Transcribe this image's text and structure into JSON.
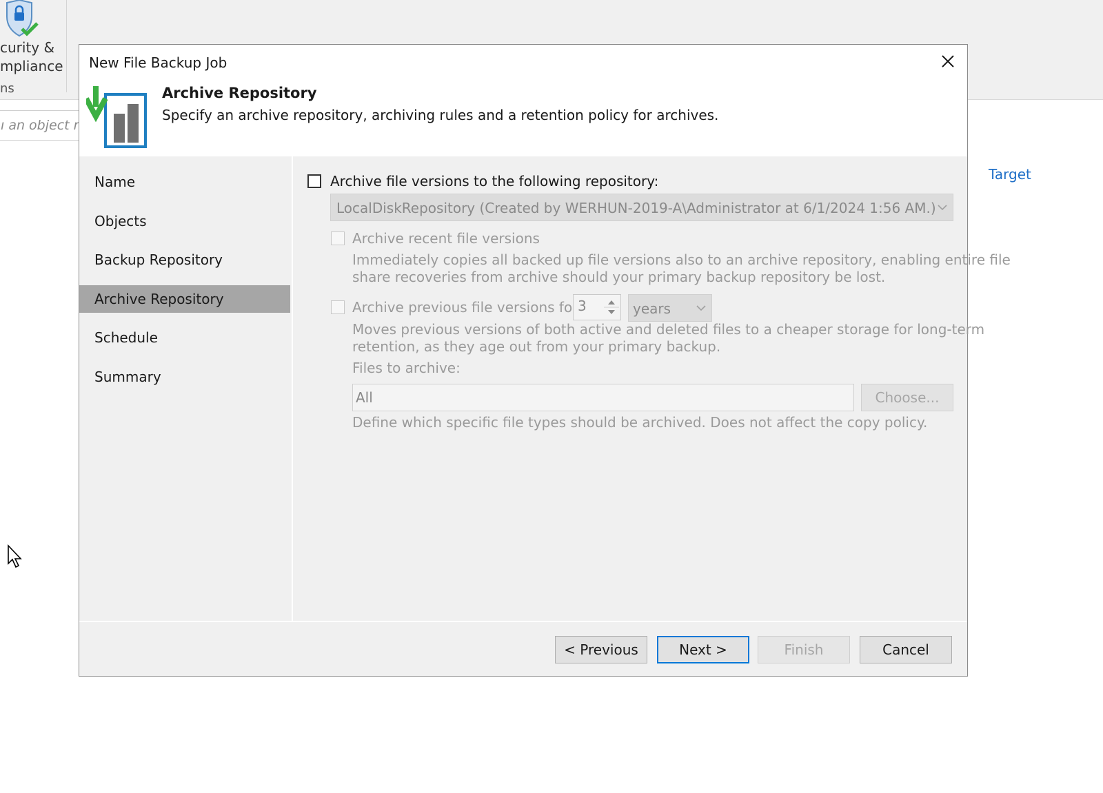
{
  "background": {
    "ribbon_label_line1": "curity &",
    "ribbon_label_line2": "mpliance",
    "ribbon_group": "ns",
    "search_placeholder": "ı an object nε",
    "target_link": "Target"
  },
  "dialog": {
    "title": "New File Backup Job",
    "header": {
      "title": "Archive Repository",
      "description": "Specify an archive repository, archiving rules and a retention policy for archives."
    },
    "nav": [
      "Name",
      "Objects",
      "Backup Repository",
      "Archive Repository",
      "Schedule",
      "Summary"
    ],
    "active_step": "Archive Repository",
    "content": {
      "archive_checkbox_label": "Archive file versions to the following repository:",
      "archive_checked": false,
      "repository_value": "LocalDiskRepository (Created by WERHUN-2019-A\\Administrator at 6/1/2024 1:56 AM.)",
      "recent_label": "Archive recent file versions",
      "recent_desc_line1": "Immediately copies all backed up file versions also to an archive repository, enabling entire file",
      "recent_desc_line2": "share recoveries from archive should your primary backup repository be lost.",
      "previous_label": "Archive previous file versions for:",
      "previous_value": "3",
      "previous_unit": "years",
      "previous_desc_line1": "Moves previous versions of both active and deleted files to a cheaper storage for long-term",
      "previous_desc_line2": "retention, as they age out from your primary backup.",
      "files_label": "Files to archive:",
      "files_value": "All",
      "choose_button": "Choose...",
      "files_desc": "Define which specific file types should be archived. Does not affect the copy policy."
    },
    "buttons": {
      "previous": "< Previous",
      "next": "Next >",
      "finish": "Finish",
      "cancel": "Cancel"
    }
  },
  "colors": {
    "accent": "#0078d7",
    "active_nav": "#a6a6a6",
    "panel_bg": "#f0f0f0",
    "link": "#1f6fc7",
    "icon_green": "#3cb043",
    "icon_blue": "#1f7fc1"
  }
}
